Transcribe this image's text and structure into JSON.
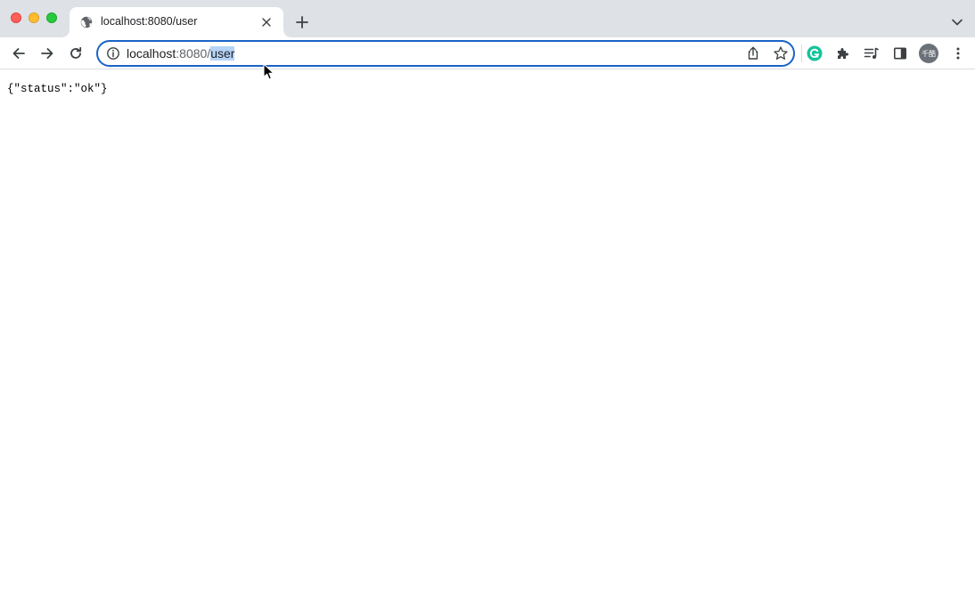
{
  "browser": {
    "tab": {
      "title": "localhost:8080/user",
      "favicon": "globe-icon"
    },
    "omnibox": {
      "url_host": "localhost",
      "url_rest": ":8080/",
      "url_selected": "user"
    },
    "profile": {
      "avatar_text": "千酷"
    },
    "colors": {
      "omnibox_border": "#1a63c7",
      "selection": "#b4d3f8",
      "tabstrip_bg": "#dee1e6"
    }
  },
  "page": {
    "body_text": "{\"status\":\"ok\"}"
  }
}
